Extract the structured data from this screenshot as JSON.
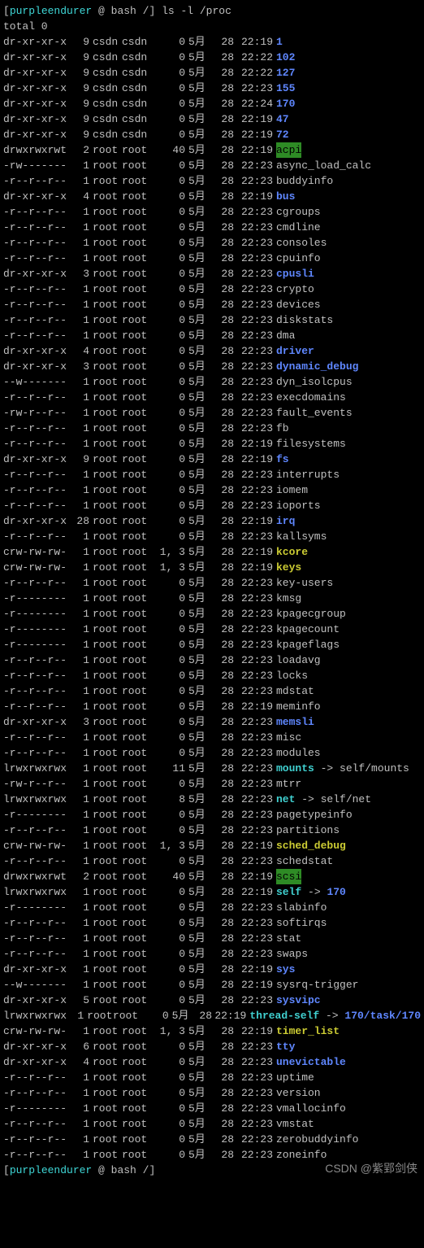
{
  "prompt": {
    "open": "[",
    "user": "purpleendurer",
    "at": " @ ",
    "shell": "bash",
    "path": " /",
    "close": "] ",
    "command": "ls -l /proc"
  },
  "total_line": "total 0",
  "final_prompt": "[purpleendurer @ bash /] ",
  "watermark": "CSDN @紫郢剑侠",
  "rows": [
    {
      "perm": "dr-xr-xr-x",
      "links": "9",
      "owner": "csdn",
      "group": "csdn",
      "size": "0",
      "month": "5月",
      "day": "28",
      "time": "22:19",
      "name": "1",
      "cls": "dir"
    },
    {
      "perm": "dr-xr-xr-x",
      "links": "9",
      "owner": "csdn",
      "group": "csdn",
      "size": "0",
      "month": "5月",
      "day": "28",
      "time": "22:22",
      "name": "102",
      "cls": "dir"
    },
    {
      "perm": "dr-xr-xr-x",
      "links": "9",
      "owner": "csdn",
      "group": "csdn",
      "size": "0",
      "month": "5月",
      "day": "28",
      "time": "22:22",
      "name": "127",
      "cls": "dir"
    },
    {
      "perm": "dr-xr-xr-x",
      "links": "9",
      "owner": "csdn",
      "group": "csdn",
      "size": "0",
      "month": "5月",
      "day": "28",
      "time": "22:23",
      "name": "155",
      "cls": "dir"
    },
    {
      "perm": "dr-xr-xr-x",
      "links": "9",
      "owner": "csdn",
      "group": "csdn",
      "size": "0",
      "month": "5月",
      "day": "28",
      "time": "22:24",
      "name": "170",
      "cls": "dir"
    },
    {
      "perm": "dr-xr-xr-x",
      "links": "9",
      "owner": "csdn",
      "group": "csdn",
      "size": "0",
      "month": "5月",
      "day": "28",
      "time": "22:19",
      "name": "47",
      "cls": "dir"
    },
    {
      "perm": "dr-xr-xr-x",
      "links": "9",
      "owner": "csdn",
      "group": "csdn",
      "size": "0",
      "month": "5月",
      "day": "28",
      "time": "22:19",
      "name": "72",
      "cls": "dir"
    },
    {
      "perm": "drwxrwxrwt",
      "links": "2",
      "owner": "root",
      "group": "root",
      "size": "40",
      "month": "5月",
      "day": "28",
      "time": "22:19",
      "name": "acpi",
      "cls": "hlgreen"
    },
    {
      "perm": "-rw-------",
      "links": "1",
      "owner": "root",
      "group": "root",
      "size": "0",
      "month": "5月",
      "day": "28",
      "time": "22:23",
      "name": "async_load_calc",
      "cls": "file"
    },
    {
      "perm": "-r--r--r--",
      "links": "1",
      "owner": "root",
      "group": "root",
      "size": "0",
      "month": "5月",
      "day": "28",
      "time": "22:23",
      "name": "buddyinfo",
      "cls": "file"
    },
    {
      "perm": "dr-xr-xr-x",
      "links": "4",
      "owner": "root",
      "group": "root",
      "size": "0",
      "month": "5月",
      "day": "28",
      "time": "22:19",
      "name": "bus",
      "cls": "dir"
    },
    {
      "perm": "-r--r--r--",
      "links": "1",
      "owner": "root",
      "group": "root",
      "size": "0",
      "month": "5月",
      "day": "28",
      "time": "22:23",
      "name": "cgroups",
      "cls": "file"
    },
    {
      "perm": "-r--r--r--",
      "links": "1",
      "owner": "root",
      "group": "root",
      "size": "0",
      "month": "5月",
      "day": "28",
      "time": "22:23",
      "name": "cmdline",
      "cls": "file"
    },
    {
      "perm": "-r--r--r--",
      "links": "1",
      "owner": "root",
      "group": "root",
      "size": "0",
      "month": "5月",
      "day": "28",
      "time": "22:23",
      "name": "consoles",
      "cls": "file"
    },
    {
      "perm": "-r--r--r--",
      "links": "1",
      "owner": "root",
      "group": "root",
      "size": "0",
      "month": "5月",
      "day": "28",
      "time": "22:23",
      "name": "cpuinfo",
      "cls": "file"
    },
    {
      "perm": "dr-xr-xr-x",
      "links": "3",
      "owner": "root",
      "group": "root",
      "size": "0",
      "month": "5月",
      "day": "28",
      "time": "22:23",
      "name": "cpusli",
      "cls": "dir"
    },
    {
      "perm": "-r--r--r--",
      "links": "1",
      "owner": "root",
      "group": "root",
      "size": "0",
      "month": "5月",
      "day": "28",
      "time": "22:23",
      "name": "crypto",
      "cls": "file"
    },
    {
      "perm": "-r--r--r--",
      "links": "1",
      "owner": "root",
      "group": "root",
      "size": "0",
      "month": "5月",
      "day": "28",
      "time": "22:23",
      "name": "devices",
      "cls": "file"
    },
    {
      "perm": "-r--r--r--",
      "links": "1",
      "owner": "root",
      "group": "root",
      "size": "0",
      "month": "5月",
      "day": "28",
      "time": "22:23",
      "name": "diskstats",
      "cls": "file"
    },
    {
      "perm": "-r--r--r--",
      "links": "1",
      "owner": "root",
      "group": "root",
      "size": "0",
      "month": "5月",
      "day": "28",
      "time": "22:23",
      "name": "dma",
      "cls": "file"
    },
    {
      "perm": "dr-xr-xr-x",
      "links": "4",
      "owner": "root",
      "group": "root",
      "size": "0",
      "month": "5月",
      "day": "28",
      "time": "22:23",
      "name": "driver",
      "cls": "dir"
    },
    {
      "perm": "dr-xr-xr-x",
      "links": "3",
      "owner": "root",
      "group": "root",
      "size": "0",
      "month": "5月",
      "day": "28",
      "time": "22:23",
      "name": "dynamic_debug",
      "cls": "dir"
    },
    {
      "perm": "--w-------",
      "links": "1",
      "owner": "root",
      "group": "root",
      "size": "0",
      "month": "5月",
      "day": "28",
      "time": "22:23",
      "name": "dyn_isolcpus",
      "cls": "file"
    },
    {
      "perm": "-r--r--r--",
      "links": "1",
      "owner": "root",
      "group": "root",
      "size": "0",
      "month": "5月",
      "day": "28",
      "time": "22:23",
      "name": "execdomains",
      "cls": "file"
    },
    {
      "perm": "-rw-r--r--",
      "links": "1",
      "owner": "root",
      "group": "root",
      "size": "0",
      "month": "5月",
      "day": "28",
      "time": "22:23",
      "name": "fault_events",
      "cls": "file"
    },
    {
      "perm": "-r--r--r--",
      "links": "1",
      "owner": "root",
      "group": "root",
      "size": "0",
      "month": "5月",
      "day": "28",
      "time": "22:23",
      "name": "fb",
      "cls": "file"
    },
    {
      "perm": "-r--r--r--",
      "links": "1",
      "owner": "root",
      "group": "root",
      "size": "0",
      "month": "5月",
      "day": "28",
      "time": "22:19",
      "name": "filesystems",
      "cls": "file"
    },
    {
      "perm": "dr-xr-xr-x",
      "links": "9",
      "owner": "root",
      "group": "root",
      "size": "0",
      "month": "5月",
      "day": "28",
      "time": "22:19",
      "name": "fs",
      "cls": "dir"
    },
    {
      "perm": "-r--r--r--",
      "links": "1",
      "owner": "root",
      "group": "root",
      "size": "0",
      "month": "5月",
      "day": "28",
      "time": "22:23",
      "name": "interrupts",
      "cls": "file"
    },
    {
      "perm": "-r--r--r--",
      "links": "1",
      "owner": "root",
      "group": "root",
      "size": "0",
      "month": "5月",
      "day": "28",
      "time": "22:23",
      "name": "iomem",
      "cls": "file"
    },
    {
      "perm": "-r--r--r--",
      "links": "1",
      "owner": "root",
      "group": "root",
      "size": "0",
      "month": "5月",
      "day": "28",
      "time": "22:23",
      "name": "ioports",
      "cls": "file"
    },
    {
      "perm": "dr-xr-xr-x",
      "links": "28",
      "owner": "root",
      "group": "root",
      "size": "0",
      "month": "5月",
      "day": "28",
      "time": "22:19",
      "name": "irq",
      "cls": "dir"
    },
    {
      "perm": "-r--r--r--",
      "links": "1",
      "owner": "root",
      "group": "root",
      "size": "0",
      "month": "5月",
      "day": "28",
      "time": "22:23",
      "name": "kallsyms",
      "cls": "file"
    },
    {
      "perm": "crw-rw-rw-",
      "links": "1",
      "owner": "root",
      "group": "root",
      "size": "1, 3",
      "month": "5月",
      "day": "28",
      "time": "22:19",
      "name": "kcore",
      "cls": "hlyellow"
    },
    {
      "perm": "crw-rw-rw-",
      "links": "1",
      "owner": "root",
      "group": "root",
      "size": "1, 3",
      "month": "5月",
      "day": "28",
      "time": "22:19",
      "name": "keys",
      "cls": "hlyellow"
    },
    {
      "perm": "-r--r--r--",
      "links": "1",
      "owner": "root",
      "group": "root",
      "size": "0",
      "month": "5月",
      "day": "28",
      "time": "22:23",
      "name": "key-users",
      "cls": "file"
    },
    {
      "perm": "-r--------",
      "links": "1",
      "owner": "root",
      "group": "root",
      "size": "0",
      "month": "5月",
      "day": "28",
      "time": "22:23",
      "name": "kmsg",
      "cls": "file"
    },
    {
      "perm": "-r--------",
      "links": "1",
      "owner": "root",
      "group": "root",
      "size": "0",
      "month": "5月",
      "day": "28",
      "time": "22:23",
      "name": "kpagecgroup",
      "cls": "file"
    },
    {
      "perm": "-r--------",
      "links": "1",
      "owner": "root",
      "group": "root",
      "size": "0",
      "month": "5月",
      "day": "28",
      "time": "22:23",
      "name": "kpagecount",
      "cls": "file"
    },
    {
      "perm": "-r--------",
      "links": "1",
      "owner": "root",
      "group": "root",
      "size": "0",
      "month": "5月",
      "day": "28",
      "time": "22:23",
      "name": "kpageflags",
      "cls": "file"
    },
    {
      "perm": "-r--r--r--",
      "links": "1",
      "owner": "root",
      "group": "root",
      "size": "0",
      "month": "5月",
      "day": "28",
      "time": "22:23",
      "name": "loadavg",
      "cls": "file"
    },
    {
      "perm": "-r--r--r--",
      "links": "1",
      "owner": "root",
      "group": "root",
      "size": "0",
      "month": "5月",
      "day": "28",
      "time": "22:23",
      "name": "locks",
      "cls": "file"
    },
    {
      "perm": "-r--r--r--",
      "links": "1",
      "owner": "root",
      "group": "root",
      "size": "0",
      "month": "5月",
      "day": "28",
      "time": "22:23",
      "name": "mdstat",
      "cls": "file"
    },
    {
      "perm": "-r--r--r--",
      "links": "1",
      "owner": "root",
      "group": "root",
      "size": "0",
      "month": "5月",
      "day": "28",
      "time": "22:19",
      "name": "meminfo",
      "cls": "file"
    },
    {
      "perm": "dr-xr-xr-x",
      "links": "3",
      "owner": "root",
      "group": "root",
      "size": "0",
      "month": "5月",
      "day": "28",
      "time": "22:23",
      "name": "memsli",
      "cls": "dir"
    },
    {
      "perm": "-r--r--r--",
      "links": "1",
      "owner": "root",
      "group": "root",
      "size": "0",
      "month": "5月",
      "day": "28",
      "time": "22:23",
      "name": "misc",
      "cls": "file"
    },
    {
      "perm": "-r--r--r--",
      "links": "1",
      "owner": "root",
      "group": "root",
      "size": "0",
      "month": "5月",
      "day": "28",
      "time": "22:23",
      "name": "modules",
      "cls": "file"
    },
    {
      "perm": "lrwxrwxrwx",
      "links": "1",
      "owner": "root",
      "group": "root",
      "size": "11",
      "month": "5月",
      "day": "28",
      "time": "22:23",
      "name": "mounts",
      "cls": "link",
      "target": "self/mounts"
    },
    {
      "perm": "-rw-r--r--",
      "links": "1",
      "owner": "root",
      "group": "root",
      "size": "0",
      "month": "5月",
      "day": "28",
      "time": "22:23",
      "name": "mtrr",
      "cls": "file"
    },
    {
      "perm": "lrwxrwxrwx",
      "links": "1",
      "owner": "root",
      "group": "root",
      "size": "8",
      "month": "5月",
      "day": "28",
      "time": "22:23",
      "name": "net",
      "cls": "link",
      "target": "self/net"
    },
    {
      "perm": "-r--------",
      "links": "1",
      "owner": "root",
      "group": "root",
      "size": "0",
      "month": "5月",
      "day": "28",
      "time": "22:23",
      "name": "pagetypeinfo",
      "cls": "file"
    },
    {
      "perm": "-r--r--r--",
      "links": "1",
      "owner": "root",
      "group": "root",
      "size": "0",
      "month": "5月",
      "day": "28",
      "time": "22:23",
      "name": "partitions",
      "cls": "file"
    },
    {
      "perm": "crw-rw-rw-",
      "links": "1",
      "owner": "root",
      "group": "root",
      "size": "1, 3",
      "month": "5月",
      "day": "28",
      "time": "22:19",
      "name": "sched_debug",
      "cls": "hlyellow"
    },
    {
      "perm": "-r--r--r--",
      "links": "1",
      "owner": "root",
      "group": "root",
      "size": "0",
      "month": "5月",
      "day": "28",
      "time": "22:23",
      "name": "schedstat",
      "cls": "file"
    },
    {
      "perm": "drwxrwxrwt",
      "links": "2",
      "owner": "root",
      "group": "root",
      "size": "40",
      "month": "5月",
      "day": "28",
      "time": "22:19",
      "name": "scsi",
      "cls": "hlgreen"
    },
    {
      "perm": "lrwxrwxrwx",
      "links": "1",
      "owner": "root",
      "group": "root",
      "size": "0",
      "month": "5月",
      "day": "28",
      "time": "22:19",
      "name": "self",
      "cls": "link",
      "target": "170",
      "targetcls": "dir"
    },
    {
      "perm": "-r--------",
      "links": "1",
      "owner": "root",
      "group": "root",
      "size": "0",
      "month": "5月",
      "day": "28",
      "time": "22:23",
      "name": "slabinfo",
      "cls": "file"
    },
    {
      "perm": "-r--r--r--",
      "links": "1",
      "owner": "root",
      "group": "root",
      "size": "0",
      "month": "5月",
      "day": "28",
      "time": "22:23",
      "name": "softirqs",
      "cls": "file"
    },
    {
      "perm": "-r--r--r--",
      "links": "1",
      "owner": "root",
      "group": "root",
      "size": "0",
      "month": "5月",
      "day": "28",
      "time": "22:23",
      "name": "stat",
      "cls": "file"
    },
    {
      "perm": "-r--r--r--",
      "links": "1",
      "owner": "root",
      "group": "root",
      "size": "0",
      "month": "5月",
      "day": "28",
      "time": "22:23",
      "name": "swaps",
      "cls": "file"
    },
    {
      "perm": "dr-xr-xr-x",
      "links": "1",
      "owner": "root",
      "group": "root",
      "size": "0",
      "month": "5月",
      "day": "28",
      "time": "22:19",
      "name": "sys",
      "cls": "dir"
    },
    {
      "perm": "--w-------",
      "links": "1",
      "owner": "root",
      "group": "root",
      "size": "0",
      "month": "5月",
      "day": "28",
      "time": "22:19",
      "name": "sysrq-trigger",
      "cls": "file"
    },
    {
      "perm": "dr-xr-xr-x",
      "links": "5",
      "owner": "root",
      "group": "root",
      "size": "0",
      "month": "5月",
      "day": "28",
      "time": "22:23",
      "name": "sysvipc",
      "cls": "dir"
    },
    {
      "perm": "lrwxrwxrwx",
      "links": "1",
      "owner": "root",
      "group": "root",
      "size": "0",
      "month": "5月",
      "day": "28",
      "time": "22:19",
      "name": "thread-self",
      "cls": "link",
      "target": "170/task/170",
      "targetcls": "dir"
    },
    {
      "perm": "crw-rw-rw-",
      "links": "1",
      "owner": "root",
      "group": "root",
      "size": "1, 3",
      "month": "5月",
      "day": "28",
      "time": "22:19",
      "name": "timer_list",
      "cls": "hlyellow"
    },
    {
      "perm": "dr-xr-xr-x",
      "links": "6",
      "owner": "root",
      "group": "root",
      "size": "0",
      "month": "5月",
      "day": "28",
      "time": "22:23",
      "name": "tty",
      "cls": "dir"
    },
    {
      "perm": "dr-xr-xr-x",
      "links": "4",
      "owner": "root",
      "group": "root",
      "size": "0",
      "month": "5月",
      "day": "28",
      "time": "22:23",
      "name": "unevictable",
      "cls": "dir"
    },
    {
      "perm": "-r--r--r--",
      "links": "1",
      "owner": "root",
      "group": "root",
      "size": "0",
      "month": "5月",
      "day": "28",
      "time": "22:23",
      "name": "uptime",
      "cls": "file"
    },
    {
      "perm": "-r--r--r--",
      "links": "1",
      "owner": "root",
      "group": "root",
      "size": "0",
      "month": "5月",
      "day": "28",
      "time": "22:23",
      "name": "version",
      "cls": "file"
    },
    {
      "perm": "-r--------",
      "links": "1",
      "owner": "root",
      "group": "root",
      "size": "0",
      "month": "5月",
      "day": "28",
      "time": "22:23",
      "name": "vmallocinfo",
      "cls": "file"
    },
    {
      "perm": "-r--r--r--",
      "links": "1",
      "owner": "root",
      "group": "root",
      "size": "0",
      "month": "5月",
      "day": "28",
      "time": "22:23",
      "name": "vmstat",
      "cls": "file"
    },
    {
      "perm": "-r--r--r--",
      "links": "1",
      "owner": "root",
      "group": "root",
      "size": "0",
      "month": "5月",
      "day": "28",
      "time": "22:23",
      "name": "zerobuddyinfo",
      "cls": "file"
    },
    {
      "perm": "-r--r--r--",
      "links": "1",
      "owner": "root",
      "group": "root",
      "size": "0",
      "month": "5月",
      "day": "28",
      "time": "22:23",
      "name": "zoneinfo",
      "cls": "file"
    }
  ]
}
